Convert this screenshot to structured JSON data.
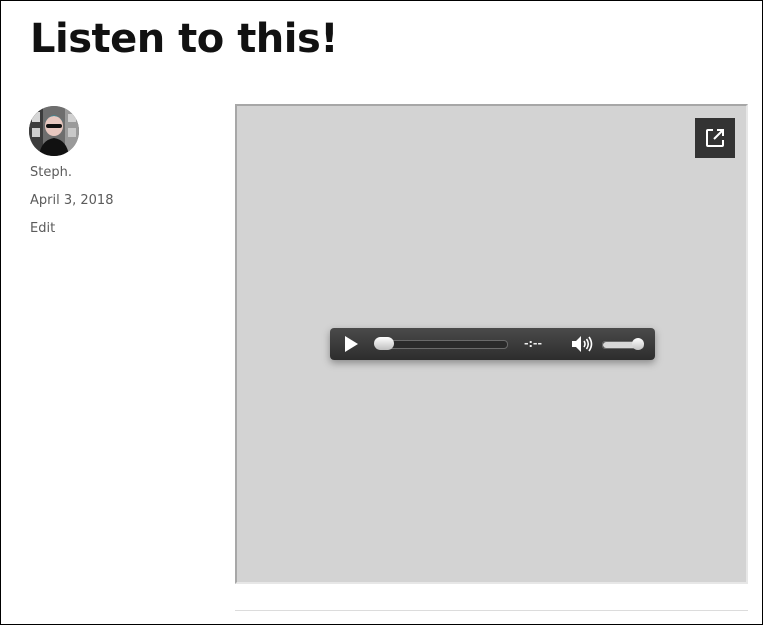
{
  "post": {
    "title": "Listen to this!"
  },
  "meta": {
    "author": "Steph.",
    "date": "April 3, 2018",
    "edit_label": "Edit",
    "avatar_icon": "author-avatar"
  },
  "media": {
    "popout_icon": "external-link-icon",
    "player": {
      "play_icon": "play-icon",
      "time_display": "-:--",
      "progress": 0.0,
      "volume_icon": "speaker-volume-icon",
      "volume_level": 0.9
    }
  }
}
